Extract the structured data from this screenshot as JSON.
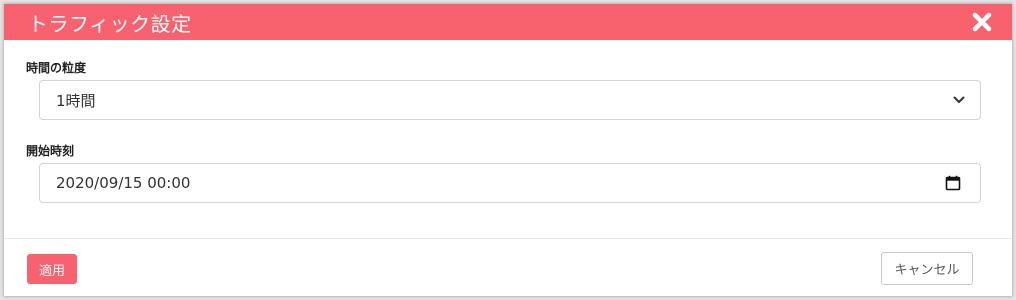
{
  "modal": {
    "title": "トラフィック設定"
  },
  "granularity": {
    "label": "時間の粒度",
    "value": "1時間"
  },
  "start_time": {
    "label": "開始時刻",
    "value": "2020/09/15 00:00"
  },
  "footer": {
    "apply_label": "適用",
    "cancel_label": "キャンセル"
  },
  "colors": {
    "accent": "#f8626f"
  }
}
